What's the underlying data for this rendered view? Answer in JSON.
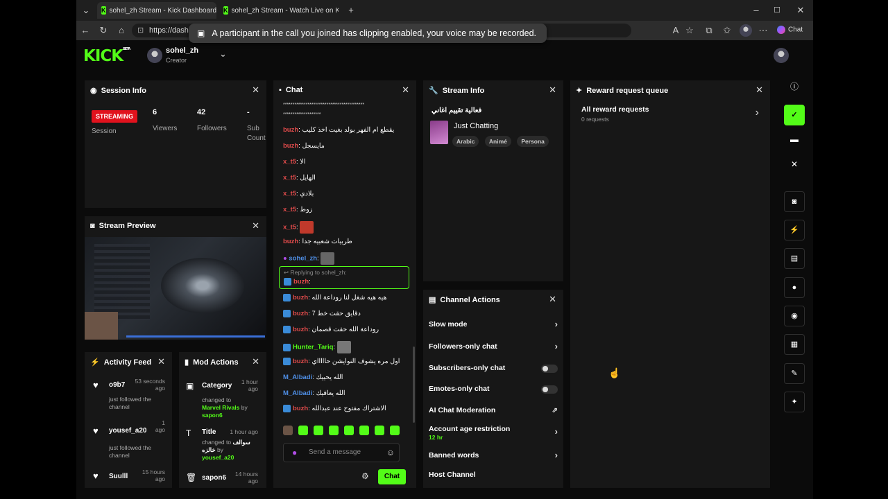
{
  "browser": {
    "tabs": [
      {
        "label": "sohel_zh Stream - Kick Dashboard"
      },
      {
        "label": "sohel_zh Stream - Watch Live on K"
      }
    ],
    "url": "https://dashboard.kick.com/moderat",
    "edge_chat_label": "Chat"
  },
  "toast": {
    "text": "A participant in the call you joined has clipping enabled, your voice may be recorded."
  },
  "header": {
    "logo": "KICK",
    "logo_sup": "BETA",
    "username": "sohel_zh",
    "role": "Creator"
  },
  "session": {
    "title": "Session Info",
    "badge": "STREAMING",
    "session_label": "Session",
    "viewers": "6",
    "viewers_label": "Viewers",
    "followers": "42",
    "followers_label": "Followers",
    "sub_count": "-",
    "sub_label_1": "Sub",
    "sub_label_2": "Count"
  },
  "preview": {
    "title": "Stream Preview"
  },
  "activity": {
    "title": "Activity Feed",
    "items": [
      {
        "name": "o9b7",
        "time1": "53 seconds",
        "time2": "ago",
        "sub1": "just followed the",
        "sub2": "channel"
      },
      {
        "name": "yousef_a20",
        "time1": "1",
        "time2": "ago",
        "sub1": "just followed the",
        "sub2": "channel"
      },
      {
        "name": "Suulll",
        "time1": "15 hours",
        "time2": "ago",
        "sub1": "",
        "sub2": ""
      }
    ]
  },
  "mod": {
    "title": "Mod Actions",
    "items": [
      {
        "action": "Category",
        "time1": "1 hour",
        "time2": "ago",
        "sub1": "changed to",
        "target": "Marvel Rivals",
        "by": "by",
        "user": "sapon6"
      },
      {
        "action": "Title",
        "time1": "1 hour ago",
        "sub1": "changed to",
        "target": "سوالف",
        "target2": "خالزه",
        "by": "by",
        "user": "yousef_a20"
      },
      {
        "action": "sapon6",
        "time1": "14 hours",
        "time2": "ago"
      }
    ]
  },
  "chat": {
    "title": "Chat",
    "top1": "*******************************************",
    "top2": "********************",
    "messages": [
      {
        "user": "buzh",
        "text": "يقطع ام الفهر بولد بغيت اخذ كليب"
      },
      {
        "user": "buzh",
        "text": "مايسجل"
      },
      {
        "user": "x_t5",
        "text": "الا"
      },
      {
        "user": "x_t5",
        "text": "الهايل"
      },
      {
        "user": "x_t5",
        "text": "بلادي"
      },
      {
        "user": "x_t5",
        "text": "زوط"
      },
      {
        "user": "x_t5",
        "text": ""
      },
      {
        "user": "buzh",
        "text": "طربيات شعبيه جدا"
      },
      {
        "user": "sohel_zh",
        "text": ""
      }
    ],
    "reply_label": "Replying to sohel_zh:",
    "reply_user": "buzh",
    "messages2": [
      {
        "user": "buzh",
        "text": "هيه هيه شغل لنا روداعة الله"
      },
      {
        "user": "buzh",
        "text": "دقايق حقت خط 7"
      },
      {
        "user": "buzh",
        "text": "روداعة الله حقت قصمان"
      },
      {
        "user": "Hunter_Tariq",
        "text": ""
      },
      {
        "user": "buzh",
        "text": "اول مره يشوف النوايشن حاااااي"
      },
      {
        "user": "M_Albadi",
        "text": "الله يحييك"
      },
      {
        "user": "M_Albadi",
        "text": "الله يعافيك"
      },
      {
        "user": "buzh",
        "text": "الاشتراك مفتوح عند عبدالله"
      }
    ],
    "placeholder": "Send a message",
    "send_label": "Chat"
  },
  "stream_info": {
    "title": "Stream Info",
    "stream_title": "فعالية تقييم اغاني",
    "category": "Just Chatting",
    "tags": [
      "Arabic",
      "Animé",
      "Persona"
    ]
  },
  "channel_actions": {
    "title": "Channel Actions",
    "slow_mode": "Slow mode",
    "followers_only": "Followers-only chat",
    "subscribers_only": "Subscribers-only chat",
    "emotes_only": "Emotes-only chat",
    "ai_mod": "AI Chat Moderation",
    "account_age": "Account age restriction",
    "account_age_value": "12 hr",
    "banned_words": "Banned words",
    "host_channel": "Host Channel"
  },
  "rewards": {
    "title": "Reward request queue",
    "all": "All reward requests",
    "count": "0 requests"
  },
  "colors": {
    "accent": "#53fc18",
    "live": "#e1121d",
    "panel": "#171717"
  }
}
